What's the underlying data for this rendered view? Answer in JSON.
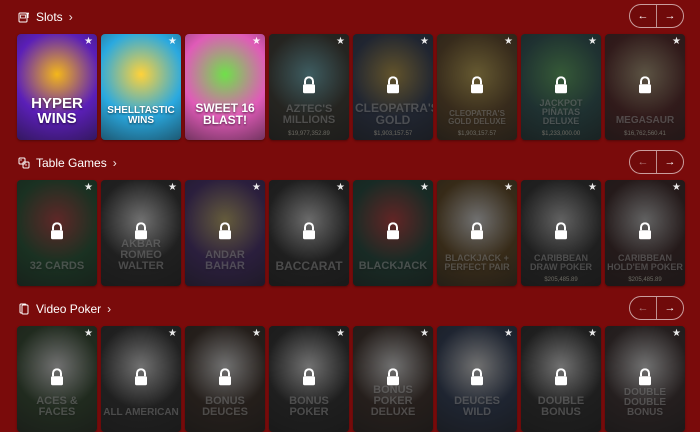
{
  "sections": [
    {
      "title": "Slots",
      "icon": "slot-machine-icon",
      "tiles": [
        {
          "title": "HYPER WINS",
          "locked": false,
          "bg": "#5b1fb8",
          "accent": "#f4b71a",
          "size": 15
        },
        {
          "title": "SHELLTASTIC WINS",
          "locked": false,
          "bg": "#2aa9e0",
          "accent": "#ffd23a",
          "size": 10
        },
        {
          "title": "SWEET 16 BLAST!",
          "locked": false,
          "bg": "#e05bb8",
          "accent": "#6fe04a",
          "size": 12
        },
        {
          "title": "AZTEC'S MILLIONS",
          "locked": true,
          "bg": "#3c3a30",
          "accent": "#7ccbd6",
          "jackpot": "$19,977,352.89",
          "size": 11
        },
        {
          "title": "CLEOPATRA'S GOLD",
          "locked": true,
          "bg": "#2f3c5a",
          "accent": "#d9b24a",
          "jackpot": "$1,903,157.57",
          "size": 12
        },
        {
          "title": "CLEOPATRA'S GOLD DELUXE",
          "locked": true,
          "bg": "#6a4a22",
          "accent": "#e3c35a",
          "jackpot": "$1,903,157.57",
          "size": 8
        },
        {
          "title": "JACKPOT PIÑATAS DELUXE",
          "locked": true,
          "bg": "#2a5a5a",
          "accent": "#66c36a",
          "jackpot": "$1,233,000.00",
          "size": 9
        },
        {
          "title": "MEGASAUR",
          "locked": true,
          "bg": "#5a2020",
          "accent": "#c9b38a",
          "jackpot": "$16,762,560.41",
          "size": 10
        }
      ]
    },
    {
      "title": "Table Games",
      "icon": "dice-icon",
      "tiles": [
        {
          "title": "32 CARDS",
          "locked": true,
          "bg": "#1d5a32",
          "accent": "#d14141",
          "size": 11
        },
        {
          "title": "AKBAR ROMEO WALTER",
          "locked": true,
          "bg": "#2d2d2d",
          "accent": "#ffffff",
          "size": 11
        },
        {
          "title": "ANDAR BAHAR",
          "locked": true,
          "bg": "#4a2a7a",
          "accent": "#e0c878",
          "size": 11
        },
        {
          "title": "BACCARAT",
          "locked": true,
          "bg": "#2a2a2a",
          "accent": "#f1f1f1",
          "size": 12
        },
        {
          "title": "BLACKJACK",
          "locked": true,
          "bg": "#1a4a3a",
          "accent": "#d83a3a",
          "size": 11
        },
        {
          "title": "BLACKJACK + PERFECT PAIR",
          "locked": true,
          "bg": "#6a4a1a",
          "accent": "#ffffff",
          "size": 9
        },
        {
          "title": "CARIBBEAN DRAW POKER",
          "locked": true,
          "bg": "#2c2c2c",
          "accent": "#d8d8d8",
          "jackpot": "$205,485.89",
          "size": 9
        },
        {
          "title": "CARIBBEAN HOLD'EM POKER",
          "locked": true,
          "bg": "#3a1f1f",
          "accent": "#d8d8d8",
          "jackpot": "$205,485.89",
          "size": 9
        }
      ]
    },
    {
      "title": "Video Poker",
      "icon": "cards-icon",
      "tiles": [
        {
          "title": "ACES & FACES",
          "locked": true,
          "bg": "#2f4a2a",
          "accent": "#ffffff",
          "size": 11
        },
        {
          "title": "ALL AMERICAN",
          "locked": true,
          "bg": "#2d2d2d",
          "accent": "#ffffff",
          "size": 10
        },
        {
          "title": "BONUS DEUCES",
          "locked": true,
          "bg": "#3a2a20",
          "accent": "#ffffff",
          "size": 11
        },
        {
          "title": "BONUS POKER",
          "locked": true,
          "bg": "#2a2a2a",
          "accent": "#ffffff",
          "size": 11
        },
        {
          "title": "BONUS POKER DELUXE",
          "locked": true,
          "bg": "#3c2a22",
          "accent": "#ffffff",
          "size": 11
        },
        {
          "title": "DEUCES WILD",
          "locked": true,
          "bg": "#2a3a5a",
          "accent": "#ffffff",
          "size": 11
        },
        {
          "title": "DOUBLE BONUS",
          "locked": true,
          "bg": "#2a2a2a",
          "accent": "#ffffff",
          "size": 11
        },
        {
          "title": "DOUBLE DOUBLE BONUS",
          "locked": true,
          "bg": "#3a2a2a",
          "accent": "#ffffff",
          "size": 10
        }
      ]
    }
  ]
}
